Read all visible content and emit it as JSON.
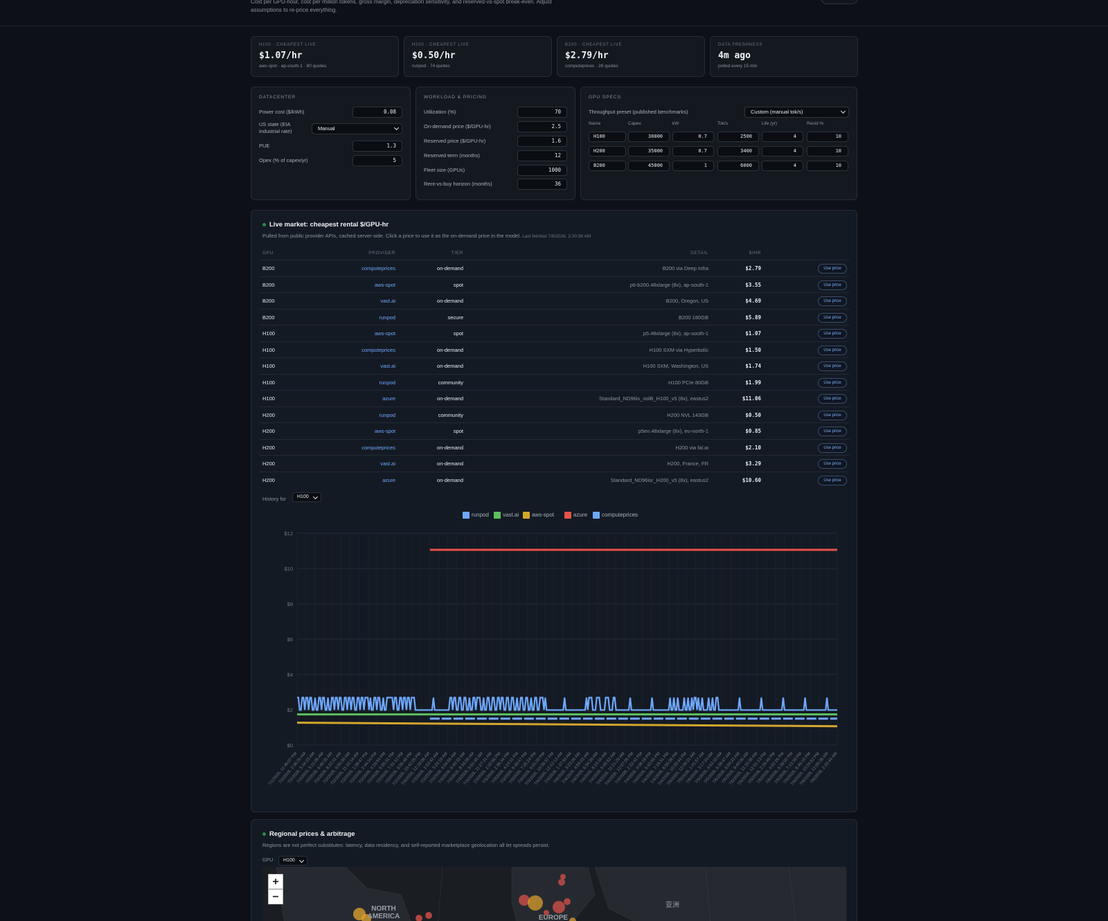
{
  "header": {
    "description": "Cost per GPU-hour, cost per million tokens, gross margin, depreciation sensitivity, and reserved-vs-spot break-even. Adjust assumptions to re-price everything."
  },
  "stats": [
    {
      "label": "H100 · cheapest live",
      "value": "$1.07/hr",
      "sub": "aws-spot · ap-south-1 · 80 quotes"
    },
    {
      "label": "H200 · cheapest live",
      "value": "$0.50/hr",
      "sub": "runpod · 74 quotes"
    },
    {
      "label": "B200 · cheapest live",
      "value": "$2.79/hr",
      "sub": "computeprices · 26 quotes"
    },
    {
      "label": "Data freshness",
      "value": "4m ago",
      "sub": "polled every 15 min"
    }
  ],
  "datacenter": {
    "title": "Datacenter",
    "power_label": "Power cost ($/kWh)",
    "power": "0.08",
    "state_label": "US state (EIA industrial rate)",
    "state": "Manual",
    "pue_label": "PUE",
    "pue": "1.3",
    "opex_label": "Opex (% of capex/yr)",
    "opex": "5"
  },
  "workload": {
    "title": "Workload & Pricing",
    "fields": [
      {
        "label": "Utilization (%)",
        "value": "70"
      },
      {
        "label": "On-demand price ($/GPU-hr)",
        "value": "2.5"
      },
      {
        "label": "Reserved price ($/GPU-hr)",
        "value": "1.6"
      },
      {
        "label": "Reserved term (months)",
        "value": "12"
      },
      {
        "label": "Fleet size (GPUs)",
        "value": "1000"
      },
      {
        "label": "Rent-vs-buy horizon (months)",
        "value": "36"
      }
    ]
  },
  "gpu_specs": {
    "title": "GPU Specs",
    "preset_label": "Throughput preset (published benchmarks)",
    "preset": "Custom (manual tok/s)",
    "columns": [
      "Name",
      "Capex",
      "kW",
      "Tok/s",
      "Life (yr)",
      "Resid %"
    ],
    "rows": [
      [
        "H100",
        "30000",
        "0.7",
        "2500",
        "4",
        "10"
      ],
      [
        "H200",
        "35000",
        "0.7",
        "3400",
        "4",
        "10"
      ],
      [
        "B200",
        "45000",
        "1",
        "6000",
        "4",
        "10"
      ]
    ]
  },
  "market": {
    "title": "Live market: cheapest rental $/GPU-hr",
    "subtitle": "Pulled from public provider APIs, cached server-side. Click a price to use it as the on-demand price in the model.",
    "fetched": "Last fetched 7/6/2026, 2:30:36 AM",
    "columns": {
      "gpu": "GPU",
      "provider": "Provider",
      "tier": "Tier",
      "detail": "Detail",
      "price": "$/hr"
    },
    "use_label": "Use price",
    "rows": [
      {
        "gpu": "B200",
        "provider": "computeprices",
        "tier": "on-demand",
        "detail": "B200 via Deep Infra",
        "price": "$2.79"
      },
      {
        "gpu": "B200",
        "provider": "aws-spot",
        "tier": "spot",
        "detail": "p6-b200.48xlarge (8x), ap-south-1",
        "price": "$3.55"
      },
      {
        "gpu": "B200",
        "provider": "vast.ai",
        "tier": "on-demand",
        "detail": "B200, Oregon, US",
        "price": "$4.69"
      },
      {
        "gpu": "B200",
        "provider": "runpod",
        "tier": "secure",
        "detail": "B200 180GB",
        "price": "$5.89"
      },
      {
        "gpu": "H100",
        "provider": "aws-spot",
        "tier": "spot",
        "detail": "p5.48xlarge (8x), ap-south-1",
        "price": "$1.07"
      },
      {
        "gpu": "H100",
        "provider": "computeprices",
        "tier": "on-demand",
        "detail": "H100 SXM via Hyperbolic",
        "price": "$1.50"
      },
      {
        "gpu": "H100",
        "provider": "vast.ai",
        "tier": "on-demand",
        "detail": "H100 SXM, Washington, US",
        "price": "$1.74"
      },
      {
        "gpu": "H100",
        "provider": "runpod",
        "tier": "community",
        "detail": "H100 PCIe 80GB",
        "price": "$1.99"
      },
      {
        "gpu": "H100",
        "provider": "azure",
        "tier": "on-demand",
        "detail": "Standard_ND96is_nolB_H100_v5 (8x), eastus2",
        "price": "$11.06"
      },
      {
        "gpu": "H200",
        "provider": "runpod",
        "tier": "community",
        "detail": "H200 NVL 143GB",
        "price": "$0.50"
      },
      {
        "gpu": "H200",
        "provider": "aws-spot",
        "tier": "spot",
        "detail": "p5en.48xlarge (8x), eu-north-1",
        "price": "$0.85"
      },
      {
        "gpu": "H200",
        "provider": "computeprices",
        "tier": "on-demand",
        "detail": "H200 via fal.ai",
        "price": "$2.10"
      },
      {
        "gpu": "H200",
        "provider": "vast.ai",
        "tier": "on-demand",
        "detail": "H200, France, FR",
        "price": "$3.29"
      },
      {
        "gpu": "H200",
        "provider": "azure",
        "tier": "on-demand",
        "detail": "Standard_ND96isr_H200_v5 (8x), eastus2",
        "price": "$10.60"
      }
    ],
    "history_label": "History for",
    "history_gpu": "H100"
  },
  "chart_data": {
    "type": "line",
    "title": "",
    "xlabel": "",
    "ylabel": "",
    "ylim": [
      0,
      12
    ],
    "y_ticks": [
      "$0",
      "$2",
      "$4",
      "$6",
      "$8",
      "$10",
      "$12"
    ],
    "grid": true,
    "legend": "top-center",
    "x": [
      "7/1/2026, 11:46:07 PM",
      "7/2/2026, 2:36:26 AM",
      "7/2/2026, 3:34:23 AM",
      "7/2/2026, 5:11:05 AM",
      "7/2/2026, 6:46:35 AM",
      "7/2/2026, 8:22:31 AM",
      "7/2/2026, 9:56:39 AM",
      "7/2/2026, 11:32:14 AM",
      "7/2/2026, 1:08:47 PM",
      "7/2/2026, 2:44:16 PM",
      "7/2/2026, 4:19:54 PM",
      "7/2/2026, 5:55:31 PM",
      "7/2/2026, 7:31:12 PM",
      "7/2/2026, 9:06:48 PM",
      "7/2/2026, 10:42:25 PM",
      "7/3/2026, 12:18:06 AM",
      "7/3/2026, 1:53:42 AM",
      "7/3/2026, 3:29:19 AM",
      "7/3/2026, 5:04:55 AM",
      "7/3/2026, 6:40:32 AM",
      "7/3/2026, 8:16:08 AM",
      "7/3/2026, 9:51:45 AM",
      "7/3/2026, 11:27:21 AM",
      "7/3/2026, 1:02:58 PM",
      "7/3/2026, 2:38:34 PM",
      "7/3/2026, 4:14:11 PM",
      "7/3/2026, 5:49:47 PM",
      "7/3/2026, 7:25:24 PM",
      "7/3/2026, 9:01:00 PM",
      "7/3/2026, 10:36:37 PM",
      "7/4/2026, 12:12:13 AM",
      "7/4/2026, 1:47:50 AM",
      "7/4/2026, 3:23:26 AM",
      "7/4/2026, 4:59:03 AM",
      "7/4/2026, 6:34:39 AM",
      "7/4/2026, 8:10:16 AM",
      "7/4/2026, 9:45:52 AM",
      "7/4/2026, 11:21:29 AM",
      "7/4/2026, 12:57:05 PM",
      "7/4/2026, 2:32:42 PM",
      "7/4/2026, 4:08:18 PM",
      "7/4/2026, 5:43:55 PM",
      "7/4/2026, 7:19:31 PM",
      "7/4/2026, 8:55:08 PM",
      "7/4/2026, 10:30:44 PM",
      "7/5/2026, 12:06:21 AM",
      "7/5/2026, 1:41:57 AM",
      "7/5/2026, 3:17:34 AM",
      "7/5/2026, 4:53:10 AM",
      "7/5/2026, 6:28:47 AM",
      "7/5/2026, 8:04:23 AM",
      "7/5/2026, 9:40:00 AM",
      "7/5/2026, 11:15:36 AM",
      "7/5/2026, 12:51:13 PM",
      "7/5/2026, 2:26:49 PM",
      "7/5/2026, 4:02:26 PM",
      "7/5/2026, 5:38:02 PM",
      "7/5/2026, 7:13:39 PM",
      "7/5/2026, 8:49:15 PM",
      "7/5/2026, 10:24:52 PM",
      "7/6/2026, 12:00:28 AM",
      "7/6/2026, 2:20:44 AM"
    ],
    "series": [
      {
        "name": "runpod",
        "color": "#6ea8fe",
        "pattern": "fluctuating",
        "low": 1.99,
        "high": 2.69
      },
      {
        "name": "vast.ai",
        "color": "#5cc05c",
        "values_const": 1.74
      },
      {
        "name": "aws-spot",
        "color": "#d4a72c",
        "start": 1.27,
        "end": 1.07
      },
      {
        "name": "azure",
        "color": "#e5534b",
        "values_const": 11.06,
        "start_index": 15
      },
      {
        "name": "computeprices",
        "color": "#6ea8fe",
        "values_const": 1.5,
        "start_index": 15,
        "dashed": true
      }
    ]
  },
  "regional": {
    "title": "Regional prices & arbitrage",
    "subtitle": "Regions are not perfect substitutes: latency, data residency, and self-reported marketplace geolocation all let spreads persist.",
    "gpu_label": "GPU",
    "gpu": "H100",
    "map_labels": {
      "north_america": "NORTH\nAMERICA",
      "europe": "EUROPE",
      "asia": "亚洲"
    },
    "zoom_in": "+",
    "zoom_out": "−"
  }
}
